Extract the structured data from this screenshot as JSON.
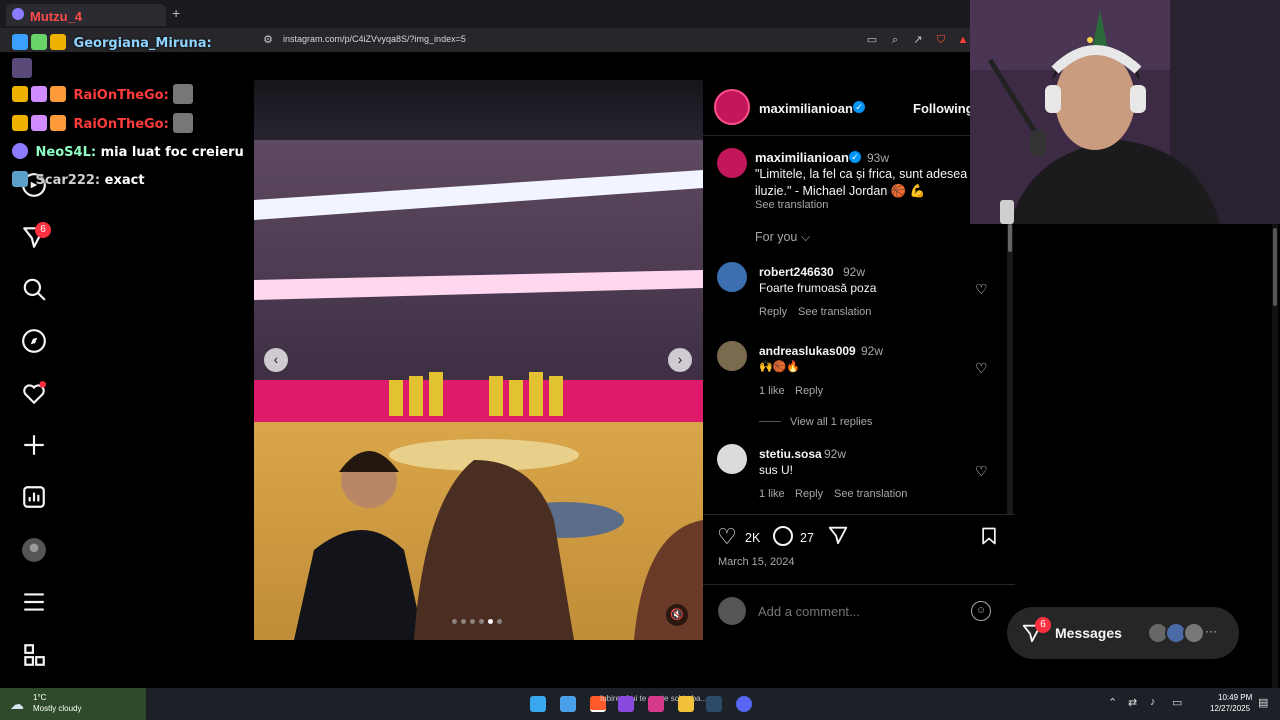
{
  "browser": {
    "tab_title": "Mutzu_4",
    "new_tab": "+",
    "url": "instagram.com/p/C4iZVvyqa8S/?img_index=5"
  },
  "chat": [
    {
      "user": "Georgiana_Miruna:",
      "message": "",
      "color": "#8fd3ff"
    },
    {
      "user": "RaiOnTheGo:",
      "message": "",
      "color": "#ff3b3b"
    },
    {
      "user": "RaiOnTheGo:",
      "message": "",
      "color": "#ff3b3b"
    },
    {
      "user": "NeoS4L:",
      "message": "mia luat foc creieru",
      "color": "#8fffc2"
    },
    {
      "user": "Scar222:",
      "message": "exact",
      "color": "#cfcfcf"
    }
  ],
  "nav": {
    "notification_badge": "6",
    "icons": [
      "messenger-icon",
      "search-icon",
      "explore-icon",
      "heart-icon",
      "create-icon",
      "dashboard-icon",
      "profile-icon",
      "menu-icon",
      "threads-icon"
    ]
  },
  "post": {
    "author": "maximilianioan",
    "follow_state": "Following",
    "caption_author": "maximilianioan",
    "caption_time": "93w",
    "caption_text": "\"Limitele, la fel ca și frica, sunt adesea iluzie.\" - Michael Jordan 🏀 💪",
    "see_translation": "See translation",
    "for_you": "For you",
    "likes": "2K",
    "comments_count": "27",
    "date": "March 15, 2024",
    "add_comment_placeholder": "Add a comment...",
    "carousel_index": 5,
    "carousel_total": 6
  },
  "comments": [
    {
      "user": "robert246630",
      "time": "92w",
      "text": "Foarte frumoasă poza",
      "actions": [
        "Reply",
        "See translation"
      ]
    },
    {
      "user": "andreaslukas009",
      "time": "92w",
      "text": "🙌🏀🔥",
      "actions": [
        "1 like",
        "Reply"
      ],
      "view_replies": "View all 1 replies"
    },
    {
      "user": "stetiu.sosa",
      "time": "92w",
      "text": "sus U!",
      "actions": [
        "1 like",
        "Reply",
        "See translation"
      ]
    }
  ],
  "messages": {
    "label": "Messages",
    "badge": "6"
  },
  "taskbar": {
    "weather_temp": "1°C",
    "weather_desc": "Mostly cloudy",
    "media_text": "Iubirea Lui te poate schimba...",
    "time": "10:49 PM",
    "date": "12/27/2025"
  },
  "colors": {
    "accent_blue": "#0095f6",
    "notification_red": "#ff3040",
    "panel_bg": "#000000"
  }
}
